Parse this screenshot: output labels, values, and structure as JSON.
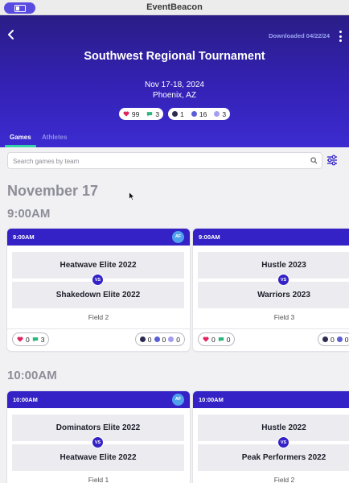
{
  "app": {
    "title": "EventBeacon"
  },
  "header": {
    "downloaded": "Downloaded 04/22/24",
    "event_title": "Southwest Regional Tournament",
    "dates": "Nov 17-18, 2024",
    "location": "Phoenix, AZ",
    "stats": {
      "hearts": "99",
      "chats": "3",
      "dark": "1",
      "blue": "16",
      "lavender": "3"
    }
  },
  "tabs": {
    "games": "Games",
    "athletes": "Athletes"
  },
  "search": {
    "placeholder": "Search games by team"
  },
  "schedule": {
    "date": "November 17",
    "slots": [
      {
        "time": "9:00AM",
        "games": [
          {
            "time": "9:00AM",
            "badge": "AF",
            "team_a": "Heatwave Elite 2022",
            "vs": "VS",
            "team_b": "Shakedown Elite 2022",
            "field": "Field 2",
            "hearts": "0",
            "chats": "3",
            "dark": "0",
            "blue": "0",
            "lavender": "0"
          },
          {
            "time": "9:00AM",
            "team_a": "Hustle 2023",
            "vs": "VS",
            "team_b": "Warriors 2023",
            "field": "Field 3",
            "hearts": "0",
            "chats": "0",
            "dark": "0",
            "blue": "0"
          }
        ]
      },
      {
        "time": "10:00AM",
        "games": [
          {
            "time": "10:00AM",
            "badge": "AF",
            "team_a": "Dominators Elite 2022",
            "vs": "VS",
            "team_b": "Heatwave Elite 2022",
            "field": "Field 1"
          },
          {
            "time": "10:00AM",
            "team_a": "Hustle 2022",
            "vs": "VS",
            "team_b": "Peak Performers 2022",
            "field": "Field 2"
          }
        ]
      }
    ]
  },
  "colors": {
    "primary": "#3422c6",
    "accent": "#36d3a8",
    "heart": "#e0245e",
    "chat": "#2cb67d"
  }
}
